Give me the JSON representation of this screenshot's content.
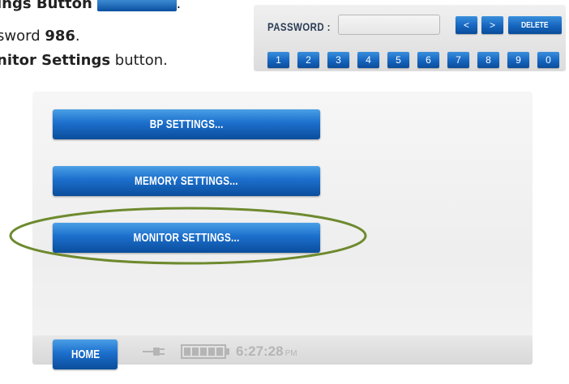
{
  "instructions": {
    "line1_bold": "ings Button",
    "line1_end": ".",
    "line2_prefix": "sword ",
    "line2_bold": "986",
    "line2_end": ".",
    "line3_bold": "nitor Settings",
    "line3_end": " button."
  },
  "password_panel": {
    "label": "PASSWORD :",
    "value": "",
    "prev_label": "<",
    "next_label": ">",
    "delete_label": "DELETE",
    "keypad": [
      "1",
      "2",
      "3",
      "4",
      "5",
      "6",
      "7",
      "8",
      "9",
      "0"
    ]
  },
  "settings_menu": {
    "bp_label": "BP SETTINGS...",
    "memory_label": "MEMORY SETTINGS...",
    "monitor_label": "MONITOR SETTINGS..."
  },
  "highlight": {
    "color": "#6e8a2e",
    "target": "monitor-settings-button"
  },
  "footer": {
    "home_label": "HOME",
    "plug_icon": "power-plug-icon",
    "battery_icon": "battery-full-icon",
    "battery_level": 1.0,
    "time": "6:27:28",
    "ampm": "PM"
  },
  "colors": {
    "button_blue_top": "#4a9fe6",
    "button_blue_bottom": "#0a4d9c",
    "panel_bg": "#f3f3f3",
    "icon_gray": "#b5b5b5"
  }
}
